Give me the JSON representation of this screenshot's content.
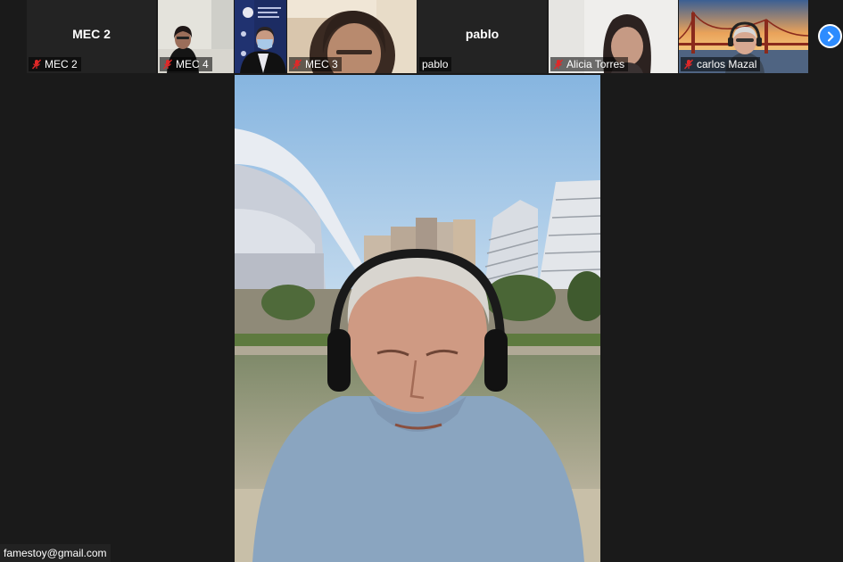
{
  "gallery": {
    "tiles": [
      {
        "label": "MEC 2",
        "display_name": "MEC 2",
        "muted": true,
        "video": false
      },
      {
        "label": "MEC 4",
        "muted": true,
        "video": true
      },
      {
        "label": "",
        "muted": false,
        "video": true
      },
      {
        "label": "MEC 3",
        "muted": true,
        "video": true
      },
      {
        "label": "pablo",
        "display_name": "pablo",
        "muted": false,
        "video": false
      },
      {
        "label": "Alicia Torres",
        "muted": true,
        "video": true
      },
      {
        "label": "carlos Mazal",
        "muted": true,
        "video": true
      }
    ],
    "next_icon": "chevron-right-icon"
  },
  "self_view": {
    "label": "famestoy@gmail.com"
  },
  "colors": {
    "background": "#1a1a1a",
    "tile_background": "#232323",
    "nav_accent": "#2d8cff",
    "muted_icon": "#e02828"
  }
}
